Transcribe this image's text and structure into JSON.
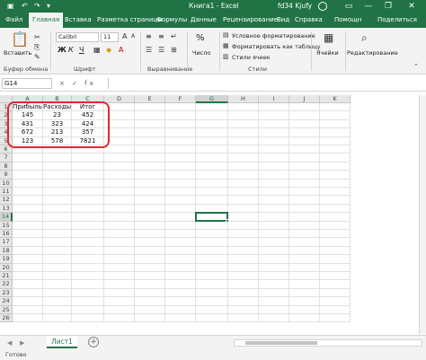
{
  "titlebar": {
    "save_icon": "save-icon",
    "undo_icon": "undo-icon",
    "redo_icon": "redo-icon",
    "title": "Книга1  -  Excel",
    "user": "fd34 Kjufy",
    "minimize": "—",
    "restore": "❐",
    "close": "✕"
  },
  "tabs": [
    {
      "label": "Файл"
    },
    {
      "label": "Главная"
    },
    {
      "label": "Вставка"
    },
    {
      "label": "Разметка страницы"
    },
    {
      "label": "Формулы"
    },
    {
      "label": "Данные"
    },
    {
      "label": "Рецензирование"
    },
    {
      "label": "Вид"
    },
    {
      "label": "Справка"
    },
    {
      "label": "Помощн"
    },
    {
      "label": "Поделиться"
    }
  ],
  "ribbon": {
    "paste_label": "Вставить",
    "font_name": "Calibri",
    "font_size": "11",
    "bold": "Ж",
    "italic": "К",
    "underline": "Ч",
    "number_label": "Число",
    "percent": "%",
    "cond_format": "Условное форматирование",
    "format_table": "Форматировать как таблицу",
    "cell_styles": "Стили ячеек",
    "cells_label": "Ячейки",
    "editing_label": "Редактирование",
    "groups": {
      "clipboard": "Буфер обмена",
      "font": "Шрифт",
      "alignment": "Выравнивание",
      "styles": "Стили"
    }
  },
  "formula_bar": {
    "name_box": "G14",
    "fx": "× ✓ fx",
    "value": ""
  },
  "columns": [
    "A",
    "B",
    "C",
    "D",
    "E",
    "F",
    "G",
    "H",
    "I",
    "J",
    "K"
  ],
  "rows": [
    "1",
    "2",
    "3",
    "4",
    "5",
    "6",
    "7",
    "8",
    "9",
    "10",
    "11",
    "12",
    "13",
    "14",
    "15",
    "16",
    "17",
    "18",
    "19",
    "20",
    "21",
    "22",
    "23",
    "24",
    "25",
    "26"
  ],
  "cells": {
    "A1": "Прибыль",
    "B1": "Расходы",
    "C1": "Итог",
    "A2": "145",
    "B2": "23",
    "C2": "452",
    "A3": "431",
    "B3": "323",
    "C3": "424",
    "A4": "672",
    "B4": "213",
    "C4": "357",
    "A5": "123",
    "B5": "578",
    "C5": "7821"
  },
  "active_cell": {
    "column": "G",
    "row": "14"
  },
  "sheets": [
    {
      "label": "Лист1"
    }
  ],
  "add_sheet": "+",
  "status": "Готово"
}
